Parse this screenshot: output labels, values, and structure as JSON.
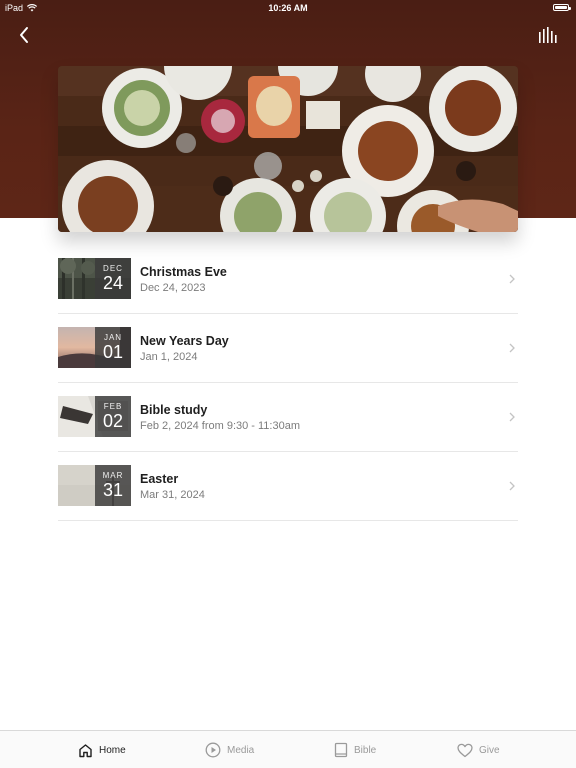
{
  "status_bar": {
    "device": "iPad",
    "time": "10:26 AM"
  },
  "nav": {
    "back_icon": "chevron-left-icon",
    "right_icon": "audio-levels-icon"
  },
  "events": [
    {
      "month": "DEC",
      "day": "24",
      "title": "Christmas Eve",
      "subtitle": "Dec 24, 2023"
    },
    {
      "month": "JAN",
      "day": "01",
      "title": "New Years Day",
      "subtitle": "Jan 1, 2024"
    },
    {
      "month": "FEB",
      "day": "02",
      "title": "Bible study",
      "subtitle": "Feb 2, 2024 from 9:30 - 11:30am"
    },
    {
      "month": "MAR",
      "day": "31",
      "title": "Easter",
      "subtitle": "Mar 31, 2024"
    }
  ],
  "tabs": [
    {
      "label": "Home",
      "icon": "home-icon",
      "active": true
    },
    {
      "label": "Media",
      "icon": "play-circle-icon",
      "active": false
    },
    {
      "label": "Bible",
      "icon": "book-icon",
      "active": false
    },
    {
      "label": "Give",
      "icon": "heart-icon",
      "active": false
    }
  ],
  "colors": {
    "header_background": "#5a2416",
    "active_tab": "#1f1f1f",
    "inactive_tab": "#9a9a9a"
  }
}
